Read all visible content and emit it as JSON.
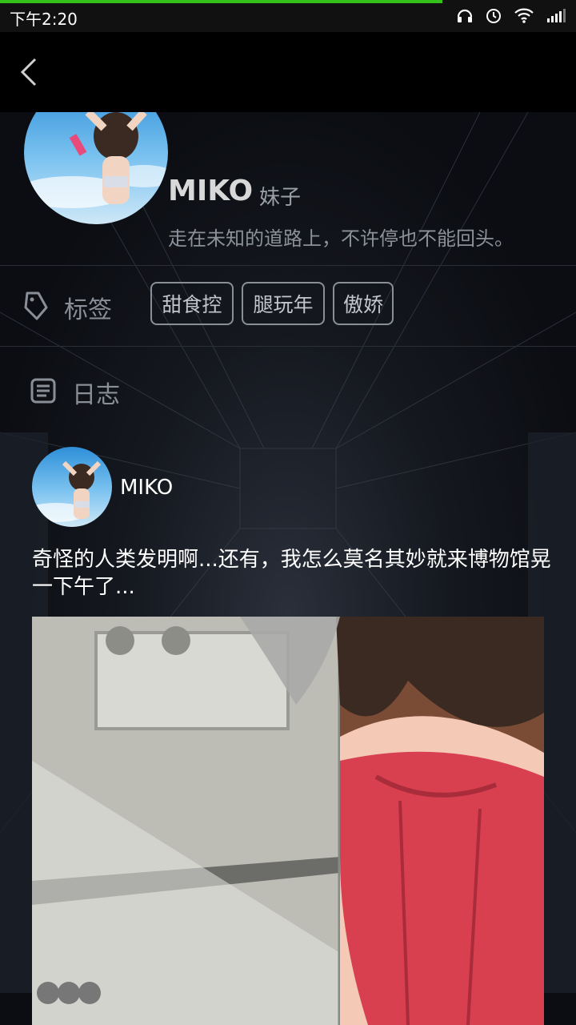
{
  "status_bar": {
    "time": "下午2:20",
    "icons": [
      "headset-icon",
      "alarm-icon",
      "wifi-icon",
      "signal-icon"
    ]
  },
  "profile": {
    "name": "MIKO",
    "gender": "妹子",
    "motto": "走在未知的道路上，不许停也不能回头。"
  },
  "tags": {
    "label": "标签",
    "items": [
      "甜食控",
      "腿玩年",
      "傲娇"
    ]
  },
  "journal": {
    "label": "日志",
    "post": {
      "user": "MIKO",
      "text": "奇怪的人类发明啊...还有，我怎么莫名其妙就来博物馆晃一下午了..."
    }
  },
  "colors": {
    "progress": "#35c11b",
    "background": "#0b0e14",
    "chip_border": "#8a8f97"
  }
}
